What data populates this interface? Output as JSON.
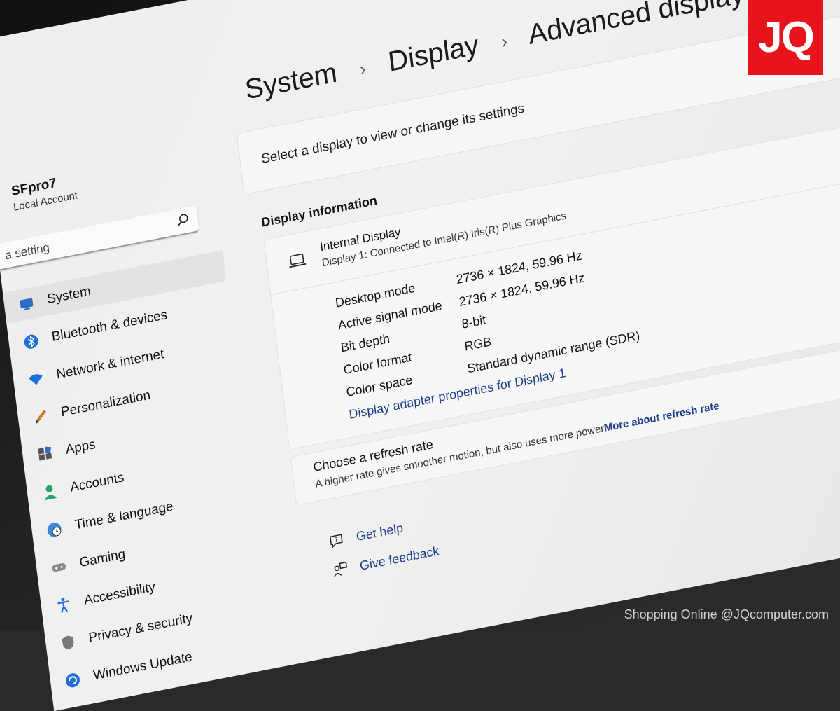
{
  "breadcrumb": {
    "root": "System",
    "middle": "Display",
    "current": "Advanced display",
    "separator": "›"
  },
  "user": {
    "name": "SFpro7",
    "account_type": "Local Account"
  },
  "search": {
    "placeholder": "a setting"
  },
  "nav": [
    {
      "label": "System",
      "icon": "system-icon",
      "active": true
    },
    {
      "label": "Bluetooth & devices",
      "icon": "bluetooth-icon"
    },
    {
      "label": "Network & internet",
      "icon": "wifi-icon"
    },
    {
      "label": "Personalization",
      "icon": "brush-icon"
    },
    {
      "label": "Apps",
      "icon": "apps-icon"
    },
    {
      "label": "Accounts",
      "icon": "person-icon"
    },
    {
      "label": "Time & language",
      "icon": "globe-clock-icon"
    },
    {
      "label": "Gaming",
      "icon": "gamepad-icon"
    },
    {
      "label": "Accessibility",
      "icon": "accessibility-icon"
    },
    {
      "label": "Privacy & security",
      "icon": "shield-icon"
    },
    {
      "label": "Windows Update",
      "icon": "refresh-icon"
    }
  ],
  "select_display": "Select a display to view or change its settings",
  "display_info": {
    "title": "Display information",
    "name": "Internal Display",
    "subtitle": "Display 1: Connected to Intel(R) Iris(R) Plus Graphics",
    "rows": [
      {
        "label": "Desktop mode",
        "value": "2736 × 1824, 59.96 Hz"
      },
      {
        "label": "Active signal mode",
        "value": "2736 × 1824, 59.96 Hz"
      },
      {
        "label": "Bit depth",
        "value": "8-bit"
      },
      {
        "label": "Color format",
        "value": "RGB"
      },
      {
        "label": "Color space",
        "value": "Standard dynamic range (SDR)"
      }
    ],
    "adapter_link": "Display adapter properties for Display 1"
  },
  "refresh": {
    "title": "Choose a refresh rate",
    "description": "A higher rate gives smoother motion, but also uses more power",
    "link": "More about refresh rate"
  },
  "help": {
    "get_help": "Get help",
    "give_feedback": "Give feedback"
  },
  "logo": {
    "text": "JQ",
    "color": "#e8141c"
  },
  "watermark": "Shopping Online @JQcomputer.com"
}
